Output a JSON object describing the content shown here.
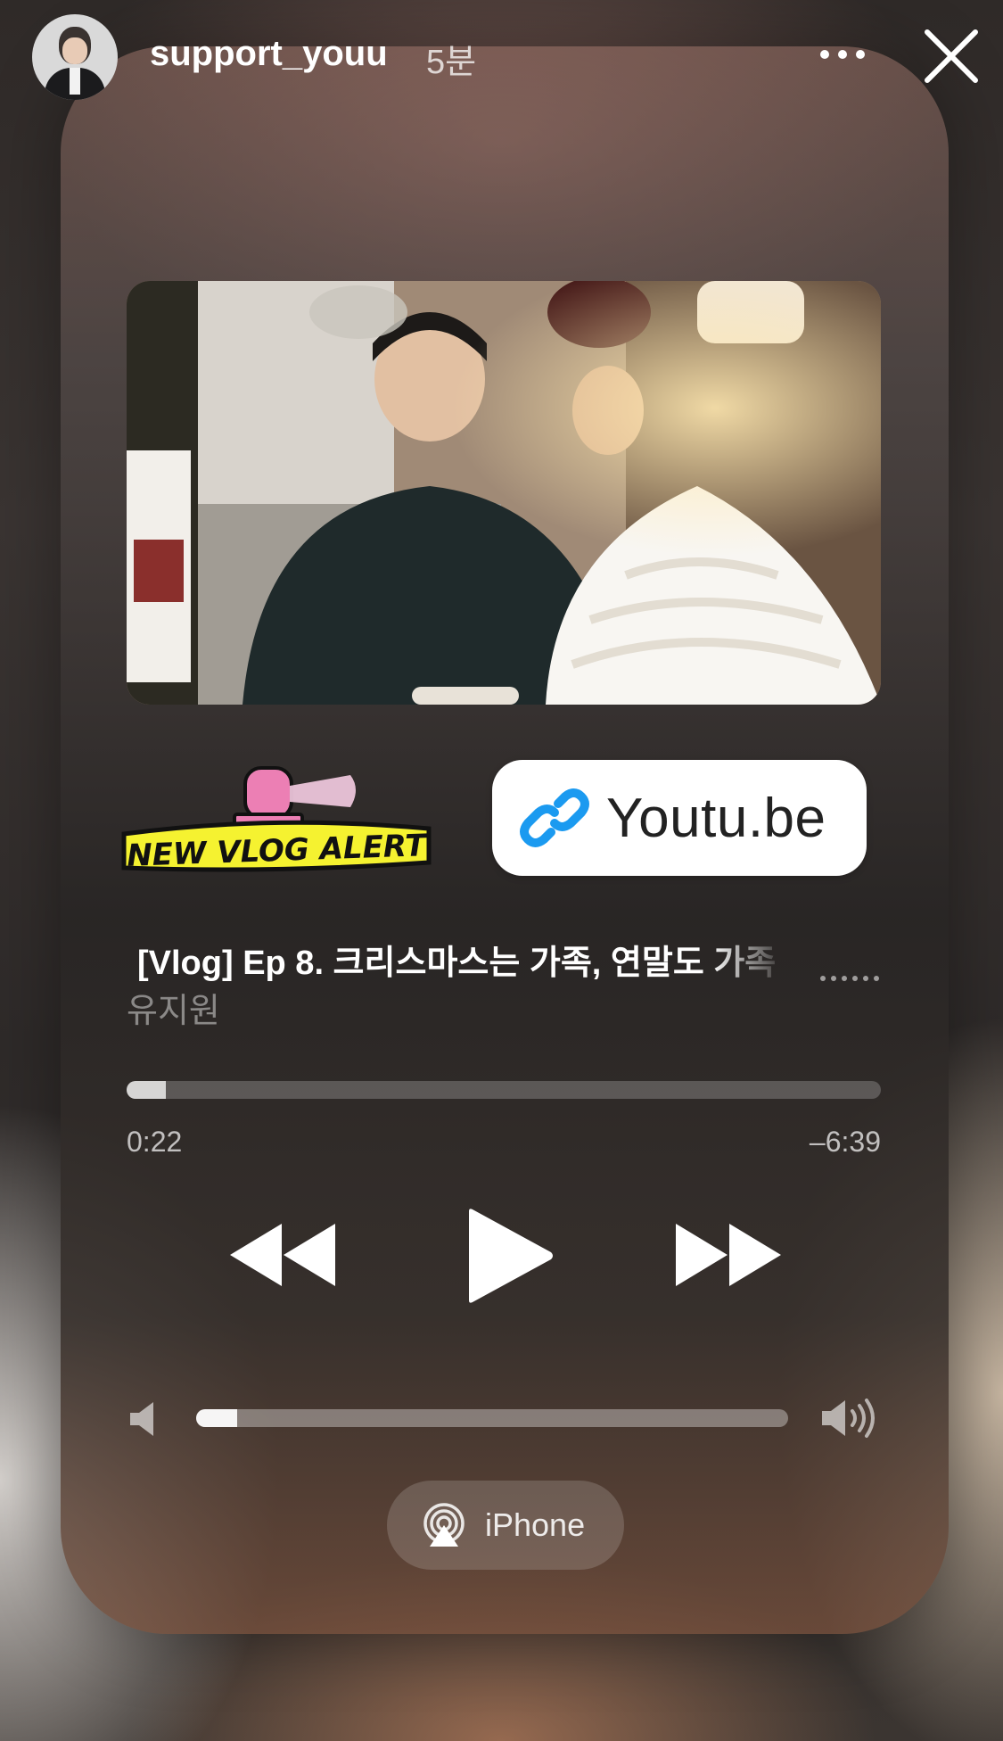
{
  "header": {
    "username": "support_youu",
    "time_ago": "5분",
    "more_icon": "more-horizontal-icon",
    "close_icon": "close-icon"
  },
  "stickers": {
    "alert_text": "NEW VLOG ALERT",
    "link_text": "Youtu.be",
    "link_icon": "link-icon"
  },
  "track": {
    "title": "[Vlog] Ep 8. 크리스마스는 가족, 연말도 가족",
    "artist": "유지원"
  },
  "playback": {
    "elapsed": "0:22",
    "remaining": "–6:39",
    "progress_fraction": 0.052
  },
  "controls": {
    "rewind_icon": "rewind-icon",
    "play_icon": "play-icon",
    "forward_icon": "fast-forward-icon"
  },
  "volume": {
    "level_fraction": 0.07
  },
  "airplay": {
    "label": "iPhone",
    "icon": "airplay-icon"
  },
  "colors": {
    "alert_yellow": "#f5f230",
    "siren_pink": "#ec7fb4",
    "link_blue": "#1b9af0"
  }
}
